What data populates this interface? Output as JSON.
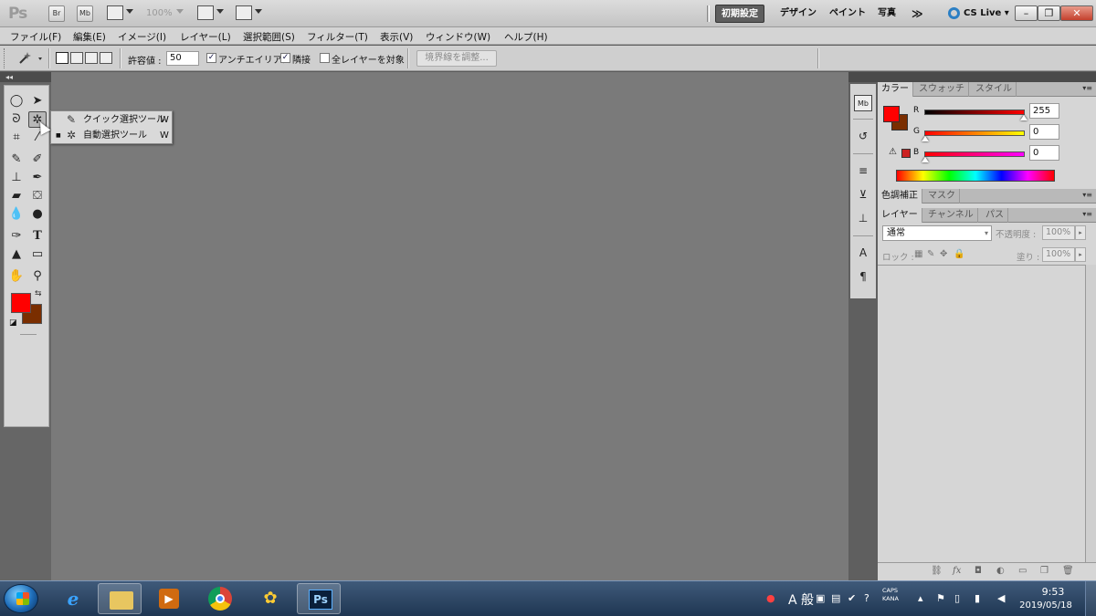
{
  "appbar": {
    "logo": "Ps",
    "bridge_label": "Br",
    "minibridge_label": "Mb",
    "zoom": "100%",
    "workspaces": [
      "初期設定",
      "デザイン",
      "ペイント",
      "写真"
    ],
    "more": "≫",
    "cslive": "CS Live",
    "window_buttons": [
      "–",
      "❐",
      "✕"
    ]
  },
  "menu": [
    "ファイル(F)",
    "編集(E)",
    "イメージ(I)",
    "レイヤー(L)",
    "選択範囲(S)",
    "フィルター(T)",
    "表示(V)",
    "ウィンドウ(W)",
    "ヘルプ(H)"
  ],
  "options": {
    "tolerance_label": "許容値 :",
    "tolerance_value": "50",
    "antialias_label": "アンチエイリアス",
    "antialias_checked": true,
    "contiguous_label": "隣接",
    "contiguous_checked": true,
    "all_layers_label": "全レイヤーを対象",
    "all_layers_checked": false,
    "refine_edge": "境界線を調整..."
  },
  "tools": {
    "flyout": [
      {
        "label": "クイック選択ツール",
        "key": "W",
        "icon": "quick-selection-icon",
        "selected": false
      },
      {
        "label": "自動選択ツール",
        "key": "W",
        "icon": "magic-wand-icon",
        "selected": true
      }
    ],
    "foreground": "#ff0000",
    "background": "#7a2e00"
  },
  "panels": {
    "color_tabs": [
      "カラー",
      "スウォッチ",
      "スタイル"
    ],
    "color": {
      "r_label": "R",
      "r_value": "255",
      "g_label": "G",
      "g_value": "0",
      "b_label": "B",
      "b_value": "0",
      "r_level": 1.0,
      "g_level": 0.0,
      "b_level": 0.0
    },
    "adjust_tabs": [
      "色調補正",
      "マスク"
    ],
    "layers_tabs": [
      "レイヤー",
      "チャンネル",
      "パス"
    ],
    "layers": {
      "blend_mode": "通常",
      "opacity_label": "不透明度 :",
      "opacity_value": "100%",
      "lock_label": "ロック :",
      "fill_label": "塗り :",
      "fill_value": "100%"
    }
  },
  "taskbar": {
    "ime": "A 般",
    "caps": "CAPS",
    "kana": "KANA",
    "time": "9:53",
    "date": "2019/05/18"
  },
  "colors": {
    "canvas": "#7a7a7a",
    "panel": "#d6d6d6",
    "taskbar": "#1f3652",
    "accent": "#2b7fc4"
  }
}
